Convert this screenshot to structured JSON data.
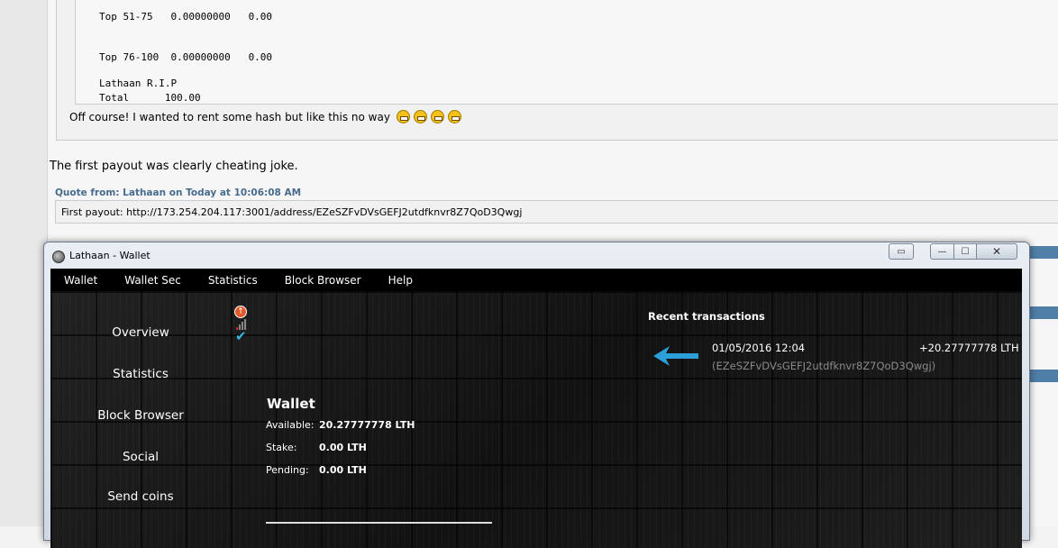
{
  "forum": {
    "code_lines": [
      "Top 51-75   0.00000000   0.00",
      "Top 76-100  0.00000000   0.00",
      "Total      100.00"
    ],
    "signature": "Lathaan R.I.P",
    "reply_text": "Off course! I wanted to rent some hash but like this no way",
    "post_text": "The first payout was clearly cheating joke.",
    "quote_header": "Quote from: Lathaan on Today at 10:06:08 AM",
    "quote_text": "First payout: http://173.254.204.117:3001/address/EZeSZFvDVsGEFJ2utdfknvr8Z7QoD3Qwgj"
  },
  "window": {
    "title": "Lathaan - Wallet",
    "menu": [
      "Wallet",
      "Wallet Sec",
      "Statistics",
      "Block Browser",
      "Help"
    ]
  },
  "nav": [
    "Overview",
    "Statistics",
    "Block Browser",
    "Social",
    "Send coins"
  ],
  "wallet": {
    "title": "Wallet",
    "available_label": "Available:",
    "available_value": "20.27777778 LTH",
    "stake_label": "Stake:",
    "stake_value": "0.00 LTH",
    "pending_label": "Pending:",
    "pending_value": "0.00 LTH"
  },
  "recent": {
    "title": "Recent transactions",
    "date": "01/05/2016 12:04",
    "amount": "+20.27777778 LTH",
    "address": "(EZeSZFvDVsGEFJ2utdfknvr8Z7QoD3Qwgj)"
  },
  "icons": [
    "upload-status-icon",
    "signal-bars-icon",
    "sync-check-icon",
    "arrow-left-icon",
    "grin-emoji-icon"
  ],
  "colors": {
    "quote_header": "#476c8e",
    "check": "#35b8e6",
    "arrow": "#2c9fd9"
  }
}
